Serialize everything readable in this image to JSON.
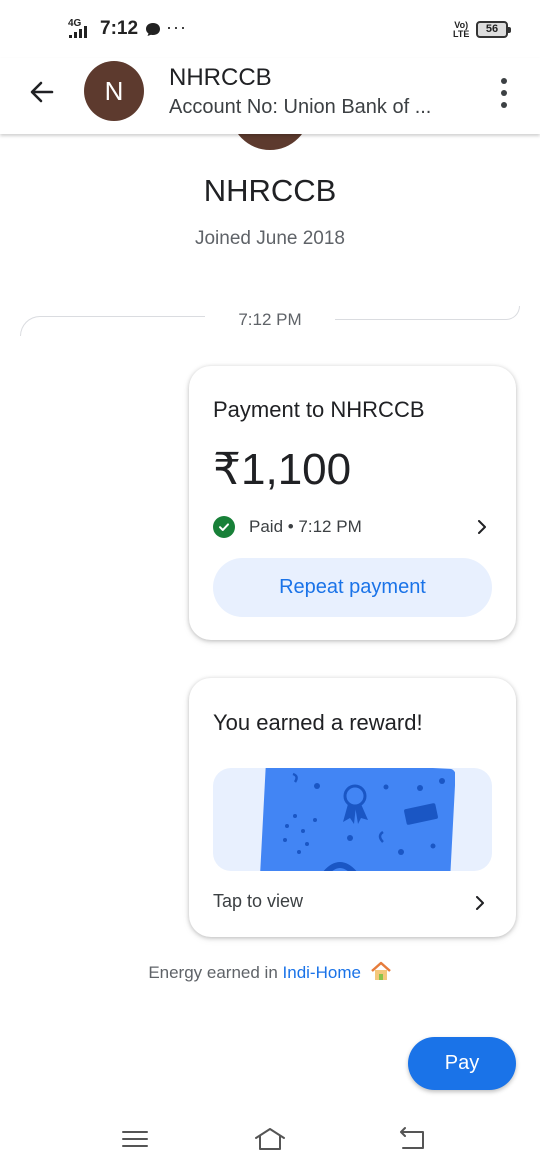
{
  "status_bar": {
    "network": "4G",
    "time": "7:12",
    "more": "···",
    "volte": "Vo)\nLTE",
    "battery": "56"
  },
  "header": {
    "avatar_letter": "N",
    "title": "NHRCCB",
    "subtitle": "Account No: Union Bank of ..."
  },
  "profile": {
    "name": "NHRCCB",
    "joined": "Joined June 2018"
  },
  "timeline": {
    "time": "7:12 PM"
  },
  "payment_card": {
    "title": "Payment to NHRCCB",
    "amount": "₹1,100",
    "status": "Paid • 7:12 PM",
    "repeat_label": "Repeat payment"
  },
  "reward_card": {
    "title": "You earned a reward!",
    "tap_label": "Tap to view"
  },
  "energy": {
    "prefix": "Energy earned in ",
    "link": "Indi-Home"
  },
  "pay_button": {
    "label": "Pay"
  },
  "colors": {
    "accent": "#1a73e8",
    "avatar": "#5d3a2e",
    "success": "#188038",
    "tint": "#e8f0fe"
  },
  "icons": {
    "back": "arrow-left-icon",
    "overflow": "more-vert-icon",
    "check": "check-circle-icon",
    "chevron": "chevron-right-icon",
    "house": "house-icon",
    "nav_menu": "menu-icon",
    "nav_home": "home-icon",
    "nav_back": "back-icon"
  }
}
